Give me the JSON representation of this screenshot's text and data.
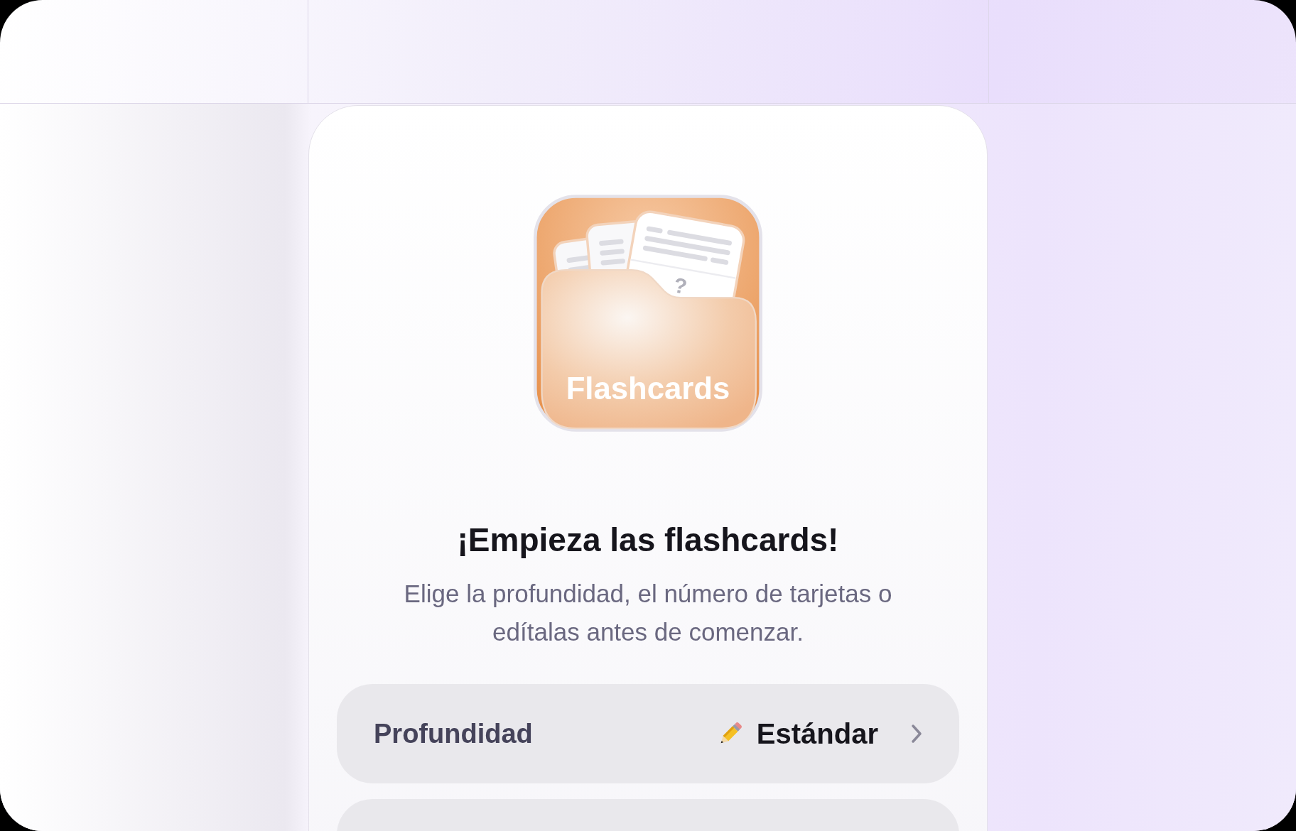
{
  "app_icon": {
    "label": "Flashcards",
    "card_mark": "?"
  },
  "title": "¡Empieza las flashcards!",
  "subtitle": "Elige la profundidad, el número de tarjetas o edítalas antes de comenzar.",
  "options": [
    {
      "kind": "depth",
      "label": "Profundidad",
      "value": "Estándar"
    }
  ]
}
